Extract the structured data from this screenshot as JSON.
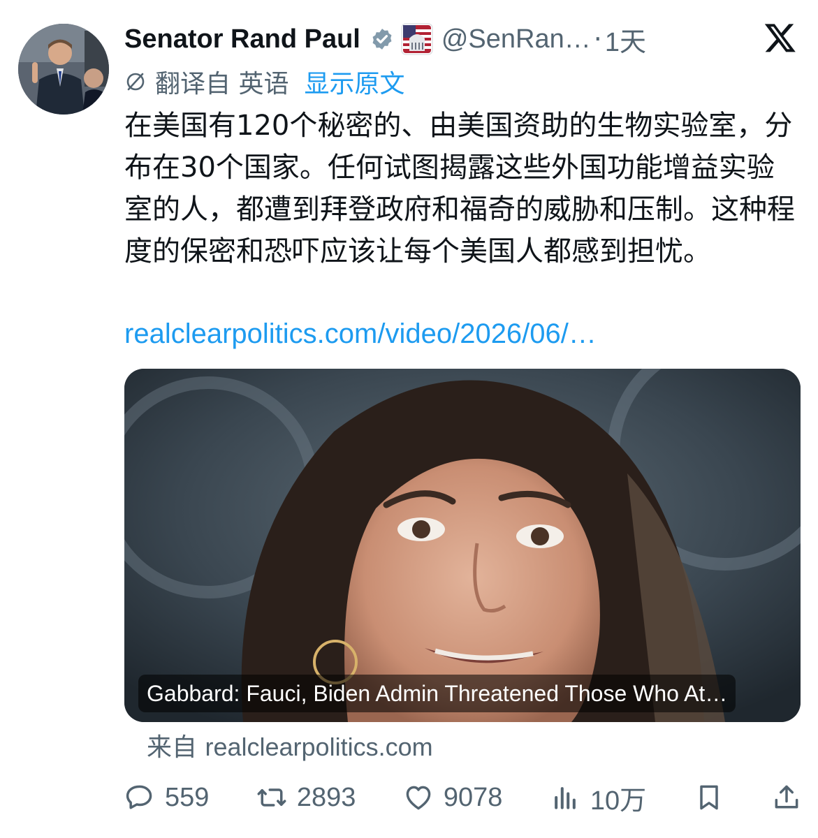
{
  "author": {
    "display_name": "Senator Rand Paul",
    "handle": "@SenRan…",
    "separator": "·",
    "time_ago": "1天",
    "verified_icon": "verified-badge-icon",
    "affiliation_icon": "us-capitol-flag-icon"
  },
  "translation": {
    "label": "翻译自 英语",
    "show_original": "显示原文",
    "icon": "translate-icon"
  },
  "tweet": {
    "text": "在美国有120个秘密的、由美国资助的生物实验室，分布在30个国家。任何试图揭露这些外国功能增益实验室的人，都遭到拜登政府和福奇的威胁和压制。这种程度的保密和恐吓应该让每个美国人都感到担忧。",
    "link": "realclearpolitics.com/video/2026/06/…"
  },
  "card": {
    "title": "Gabbard: Fauci, Biden Admin Threatened Those Who At…",
    "source_prefix": "来自",
    "source_domain": "realclearpolitics.com"
  },
  "actions": {
    "replies": "559",
    "retweets": "2893",
    "likes": "9078",
    "views": "10万"
  },
  "colors": {
    "text": "#0f1419",
    "secondary": "#536471",
    "link": "#1d9bf0",
    "verified": "#829aab"
  }
}
